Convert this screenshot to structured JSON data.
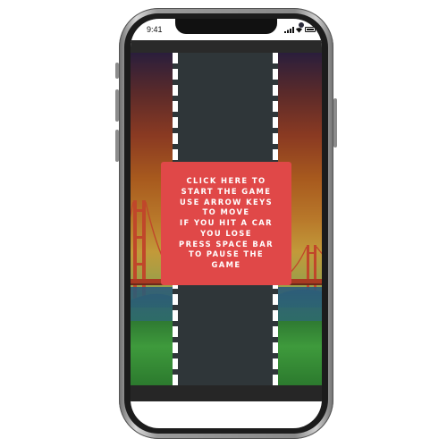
{
  "status_bar": {
    "time": "9:41",
    "icons": [
      "cellular-signal-icon",
      "wifi-icon",
      "battery-icon"
    ]
  },
  "game": {
    "start_overlay": {
      "lines": [
        "CLICK HERE TO",
        "START THE GAME",
        "USE ARROW KEYS",
        "TO MOVE",
        "IF YOU HIT A CAR",
        "YOU LOSE",
        "PRESS SPACE BAR",
        "TO PAUSE THE",
        "GAME"
      ]
    }
  },
  "colors": {
    "overlay": "#e04848",
    "road": "#2f3639",
    "lane_marking": "#ffffff",
    "bridge": "#c0472a",
    "grass": "#3e9a3c"
  }
}
